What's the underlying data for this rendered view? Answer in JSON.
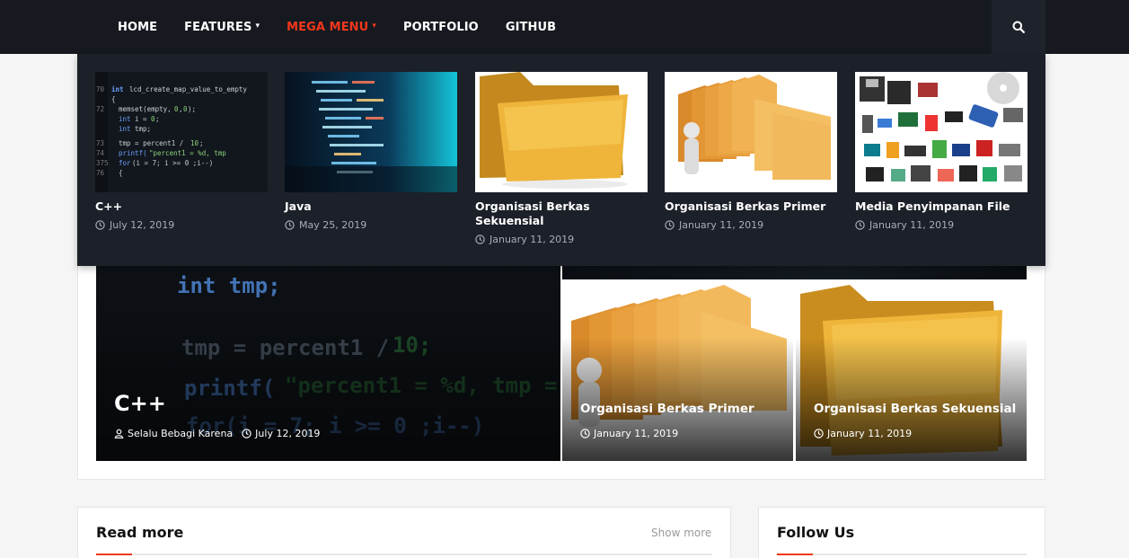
{
  "nav": {
    "items": [
      {
        "label": "HOME",
        "dropdown": false,
        "active": false
      },
      {
        "label": "FEATURES",
        "dropdown": true,
        "active": false
      },
      {
        "label": "MEGA MENU",
        "dropdown": true,
        "active": true
      },
      {
        "label": "PORTFOLIO",
        "dropdown": false,
        "active": false
      },
      {
        "label": "GITHUB",
        "dropdown": false,
        "active": false
      }
    ],
    "search_icon": "search-icon"
  },
  "mega_menu": {
    "posts": [
      {
        "title": "C++",
        "date": "July 12, 2019",
        "thumb": "code-screen"
      },
      {
        "title": "Java",
        "date": "May 25, 2019",
        "thumb": "code-blue"
      },
      {
        "title": "Organisasi Berkas Sekuensial",
        "date": "January 11, 2019",
        "thumb": "folder"
      },
      {
        "title": "Organisasi Berkas Primer",
        "date": "January 11, 2019",
        "thumb": "folders-figure"
      },
      {
        "title": "Media Penyimpanan File",
        "date": "January 11, 2019",
        "thumb": "storage-media"
      }
    ]
  },
  "featured": {
    "big": {
      "title": "C++",
      "author": "Selalu Bebagi Karena",
      "date": "July 12, 2019"
    },
    "small": [
      {
        "title": "Organisasi Berkas Primer",
        "date": "January 11, 2019"
      },
      {
        "title": "Organisasi Berkas Sekuensial",
        "date": "January 11, 2019"
      }
    ]
  },
  "read_more": {
    "title": "Read more",
    "show_more": "Show more"
  },
  "follow_us": {
    "title": "Follow Us"
  },
  "colors": {
    "accent": "#f2371c",
    "nav_bg": "#161a20",
    "mega_bg": "#1c2029"
  }
}
